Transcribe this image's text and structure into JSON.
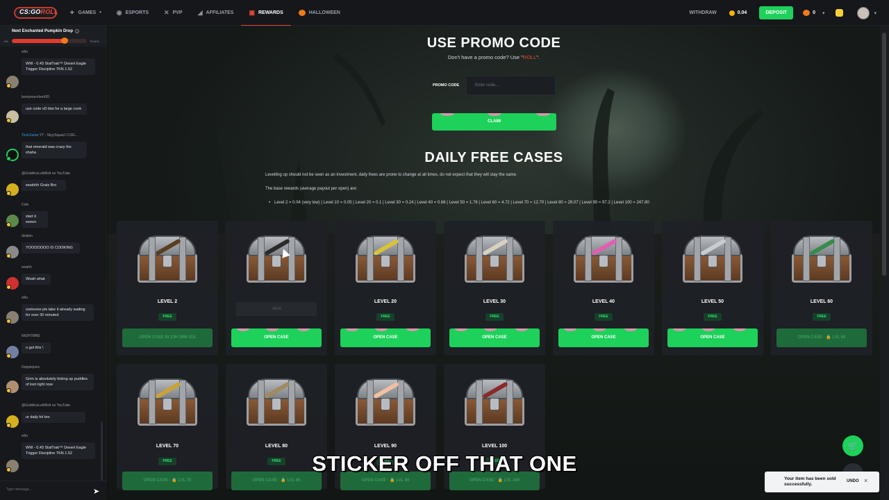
{
  "nav": {
    "logo_text": "CS:GO",
    "logo_suffix": "ROLL",
    "items": [
      {
        "label": "GAMES",
        "icon": "gamepad-icon"
      },
      {
        "label": "ESPORTS",
        "icon": "controller-icon"
      },
      {
        "label": "PVP",
        "icon": "swords-icon"
      },
      {
        "label": "AFFILIATES",
        "icon": "megaphone-icon"
      },
      {
        "label": "REWARDS",
        "icon": "gift-icon"
      },
      {
        "label": "HALLOWEEN",
        "icon": "pumpkin-icon"
      }
    ],
    "withdraw": "WITHDRAW",
    "balance": "0.04",
    "deposit": "DEPOSIT",
    "pumpkins": "0"
  },
  "sidebar": {
    "drop_title": "Next Enchanted Pumpkin Drop",
    "drop_min": "0%",
    "drop_max": "70.81%",
    "drop_progress": 0.7081,
    "messages": [
      {
        "user": "eRo",
        "text": "WW - 0.43 StatTrak™ Desert Eagle Trigger Discipline TKN 1.52"
      },
      {
        "user": "bootymuncher420",
        "text": "use code xD btw for a large cook"
      },
      {
        "user": "ToxicSanta",
        "user_suffix": "YT - SkyySquad I CSG...",
        "text": "that emerald was crazy tho shaha"
      },
      {
        "user": "@GoldAceLetitRoll on YouTube",
        "text": "woahhh Gratz Bro"
      },
      {
        "user": "Cole",
        "text": "start it eeeen"
      },
      {
        "user": "dzejian",
        "text": "YOOOOOOO IS COOKING"
      },
      {
        "user": "woahh",
        "text": "Woah what"
      },
      {
        "user": "eRo",
        "text": "someone pls take it already waiting for over 30 minuted"
      },
      {
        "user": "NIGHTMRE",
        "text": "u got this \\"
      },
      {
        "user": "Dopplejuice",
        "text": "Grim is absolutely licking up puddles of loot right now"
      },
      {
        "user": "@GoldAceLetitRoll on YouTube",
        "text": "ur daily hit bro"
      },
      {
        "user": "eRo",
        "text": "WW - 0.43 StatTrak™ Desert Eagle Trigger Discipline TKN 1.52"
      }
    ],
    "chat_placeholder": "Type message..."
  },
  "promo": {
    "title": "USE PROMO CODE",
    "subtitle_prefix": "Don't have a promo code? Use \"",
    "subtitle_code": "ROLL",
    "subtitle_suffix": "\".",
    "label": "PROMO CODE",
    "placeholder": "Enter code...",
    "claim": "CLAIM"
  },
  "daily": {
    "title": "DAILY FREE CASES",
    "desc1": "Levelling up should not be seen as an investment, daily frees are prone to change at all times, do not expect that they will stay the same.",
    "desc2": "The base rewards (average payout per open) are:",
    "desc3": "Level 2 = 0.04 (very low) | Level 10 = 0.05 | Level 20 = 0.1 | Level 30 = 0.24 | Level 40 = 0.66 | Level 50 = 1.76 | Level 60 = 4.72 | Level 70 = 12.70 | Level 80 = 29.07 | Level 90 = 97.2 | Level 100 = 247.80",
    "free_label": "FREE",
    "view_label": "VIEW",
    "cases": [
      {
        "level": "LEVEL 2",
        "button": "OPEN CASE IN 23H 38M 51S",
        "enabled": false,
        "knife_color": "#5a3d22"
      },
      {
        "level": "",
        "button": "OPEN CASE",
        "enabled": true,
        "knife_color": "#2a2a2a",
        "view": true
      },
      {
        "level": "LEVEL 20",
        "button": "OPEN CASE",
        "enabled": true,
        "knife_color": "#d9c23a"
      },
      {
        "level": "LEVEL 30",
        "button": "OPEN CASE",
        "enabled": true,
        "knife_color": "#d8d0c0"
      },
      {
        "level": "LEVEL 40",
        "button": "OPEN CASE",
        "enabled": true,
        "knife_color": "#e060b0"
      },
      {
        "level": "LEVEL 50",
        "button": "OPEN CASE",
        "enabled": true,
        "knife_color": "#c9cdd2"
      },
      {
        "level": "LEVEL 60",
        "button": "OPEN CASE · 🔒 LVL 60",
        "enabled": false,
        "knife_color": "#3a8a4a"
      },
      {
        "level": "LEVEL 70",
        "button": "OPEN CASE · 🔒 LVL 70",
        "enabled": false,
        "knife_color": "#caa23a"
      },
      {
        "level": "LEVEL 80",
        "button": "OPEN CASE · 🔒 LVL 80",
        "enabled": false,
        "knife_color": "#a08a60"
      },
      {
        "level": "LEVEL 90",
        "button": "OPEN CASE · 🔒 LVL 90",
        "enabled": false,
        "knife_color": "#f0c0a0"
      },
      {
        "level": "LEVEL 100",
        "button": "OPEN CASE · 🔒 LVL 100",
        "enabled": false,
        "knife_color": "#8a2a2a"
      }
    ]
  },
  "overlay_subtitle": "STICKER OFF THAT ONE",
  "toast": {
    "message": "Your item has been sold successfully.",
    "undo": "UNDO",
    "close": "×"
  },
  "colors": {
    "accent_green": "#1dd15a",
    "accent_red": "#e74b36"
  }
}
